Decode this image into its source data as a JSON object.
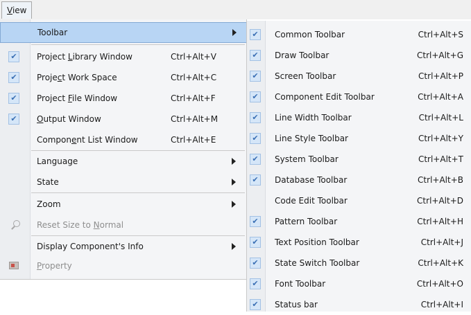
{
  "menubar": {
    "view_prefix": "",
    "view_mnemonic": "V",
    "view_rest": "iew"
  },
  "view_menu": {
    "toolbar": {
      "label": "Toolbar"
    },
    "project_library": {
      "pre": "Project ",
      "mn": "L",
      "post": "ibrary Window",
      "shortcut": "Ctrl+Alt+V",
      "checked": true
    },
    "project_workspace": {
      "pre": "Proje",
      "mn": "c",
      "post": "t Work Space",
      "shortcut": "Ctrl+Alt+C",
      "checked": true
    },
    "project_file": {
      "pre": "Project ",
      "mn": "F",
      "post": "ile Window",
      "shortcut": "Ctrl+Alt+F",
      "checked": true
    },
    "output": {
      "pre": "",
      "mn": "O",
      "post": "utput Window",
      "shortcut": "Ctrl+Alt+M",
      "checked": true
    },
    "component_list": {
      "pre": "Compon",
      "mn": "e",
      "post": "nt List Window",
      "shortcut": "Ctrl+Alt+E",
      "checked": false
    },
    "language": {
      "label": "Language"
    },
    "state": {
      "label": "State"
    },
    "zoom": {
      "label": "Zoom"
    },
    "reset_size": {
      "pre": "Reset Size to ",
      "mn": "N",
      "post": "ormal",
      "icon": "zoom-icon"
    },
    "display_info": {
      "label": "Display Component's Info"
    },
    "property": {
      "pre": "",
      "mn": "P",
      "post": "roperty",
      "icon": "property-icon"
    }
  },
  "toolbar_submenu": {
    "items": [
      {
        "label": "Common Toolbar",
        "shortcut": "Ctrl+Alt+S",
        "checked": true
      },
      {
        "label": "Draw Toolbar",
        "shortcut": "Ctrl+Alt+G",
        "checked": true
      },
      {
        "label": "Screen Toolbar",
        "shortcut": "Ctrl+Alt+P",
        "checked": true
      },
      {
        "label": "Component Edit Toolbar",
        "shortcut": "Ctrl+Alt+A",
        "checked": true
      },
      {
        "label": "Line Width Toolbar",
        "shortcut": "Ctrl+Alt+L",
        "checked": true
      },
      {
        "label": "Line Style Toolbar",
        "shortcut": "Ctrl+Alt+Y",
        "checked": true
      },
      {
        "label": "System Toolbar",
        "shortcut": "Ctrl+Alt+T",
        "checked": true
      },
      {
        "label": "Database Toolbar",
        "shortcut": "Ctrl+Alt+B",
        "checked": true
      },
      {
        "label": "Code Edit Toolbar",
        "shortcut": "Ctrl+Alt+D",
        "checked": false
      },
      {
        "label": "Pattern Toolbar",
        "shortcut": "Ctrl+Alt+H",
        "checked": true
      },
      {
        "label": "Text Position Toolbar",
        "shortcut": "Ctrl+Alt+J",
        "checked": true
      },
      {
        "label": "State Switch Toolbar",
        "shortcut": "Ctrl+Alt+K",
        "checked": true
      },
      {
        "label": "Font Toolbar",
        "shortcut": "Ctrl+Alt+O",
        "checked": true
      },
      {
        "label": "Status bar",
        "shortcut": "Ctrl+Alt+I",
        "checked": true
      }
    ]
  },
  "check_glyph": "✔",
  "colors": {
    "highlight": "#b8d5f4",
    "check_box": "#d5e6f8",
    "check_mark": "#3a6fb4"
  }
}
